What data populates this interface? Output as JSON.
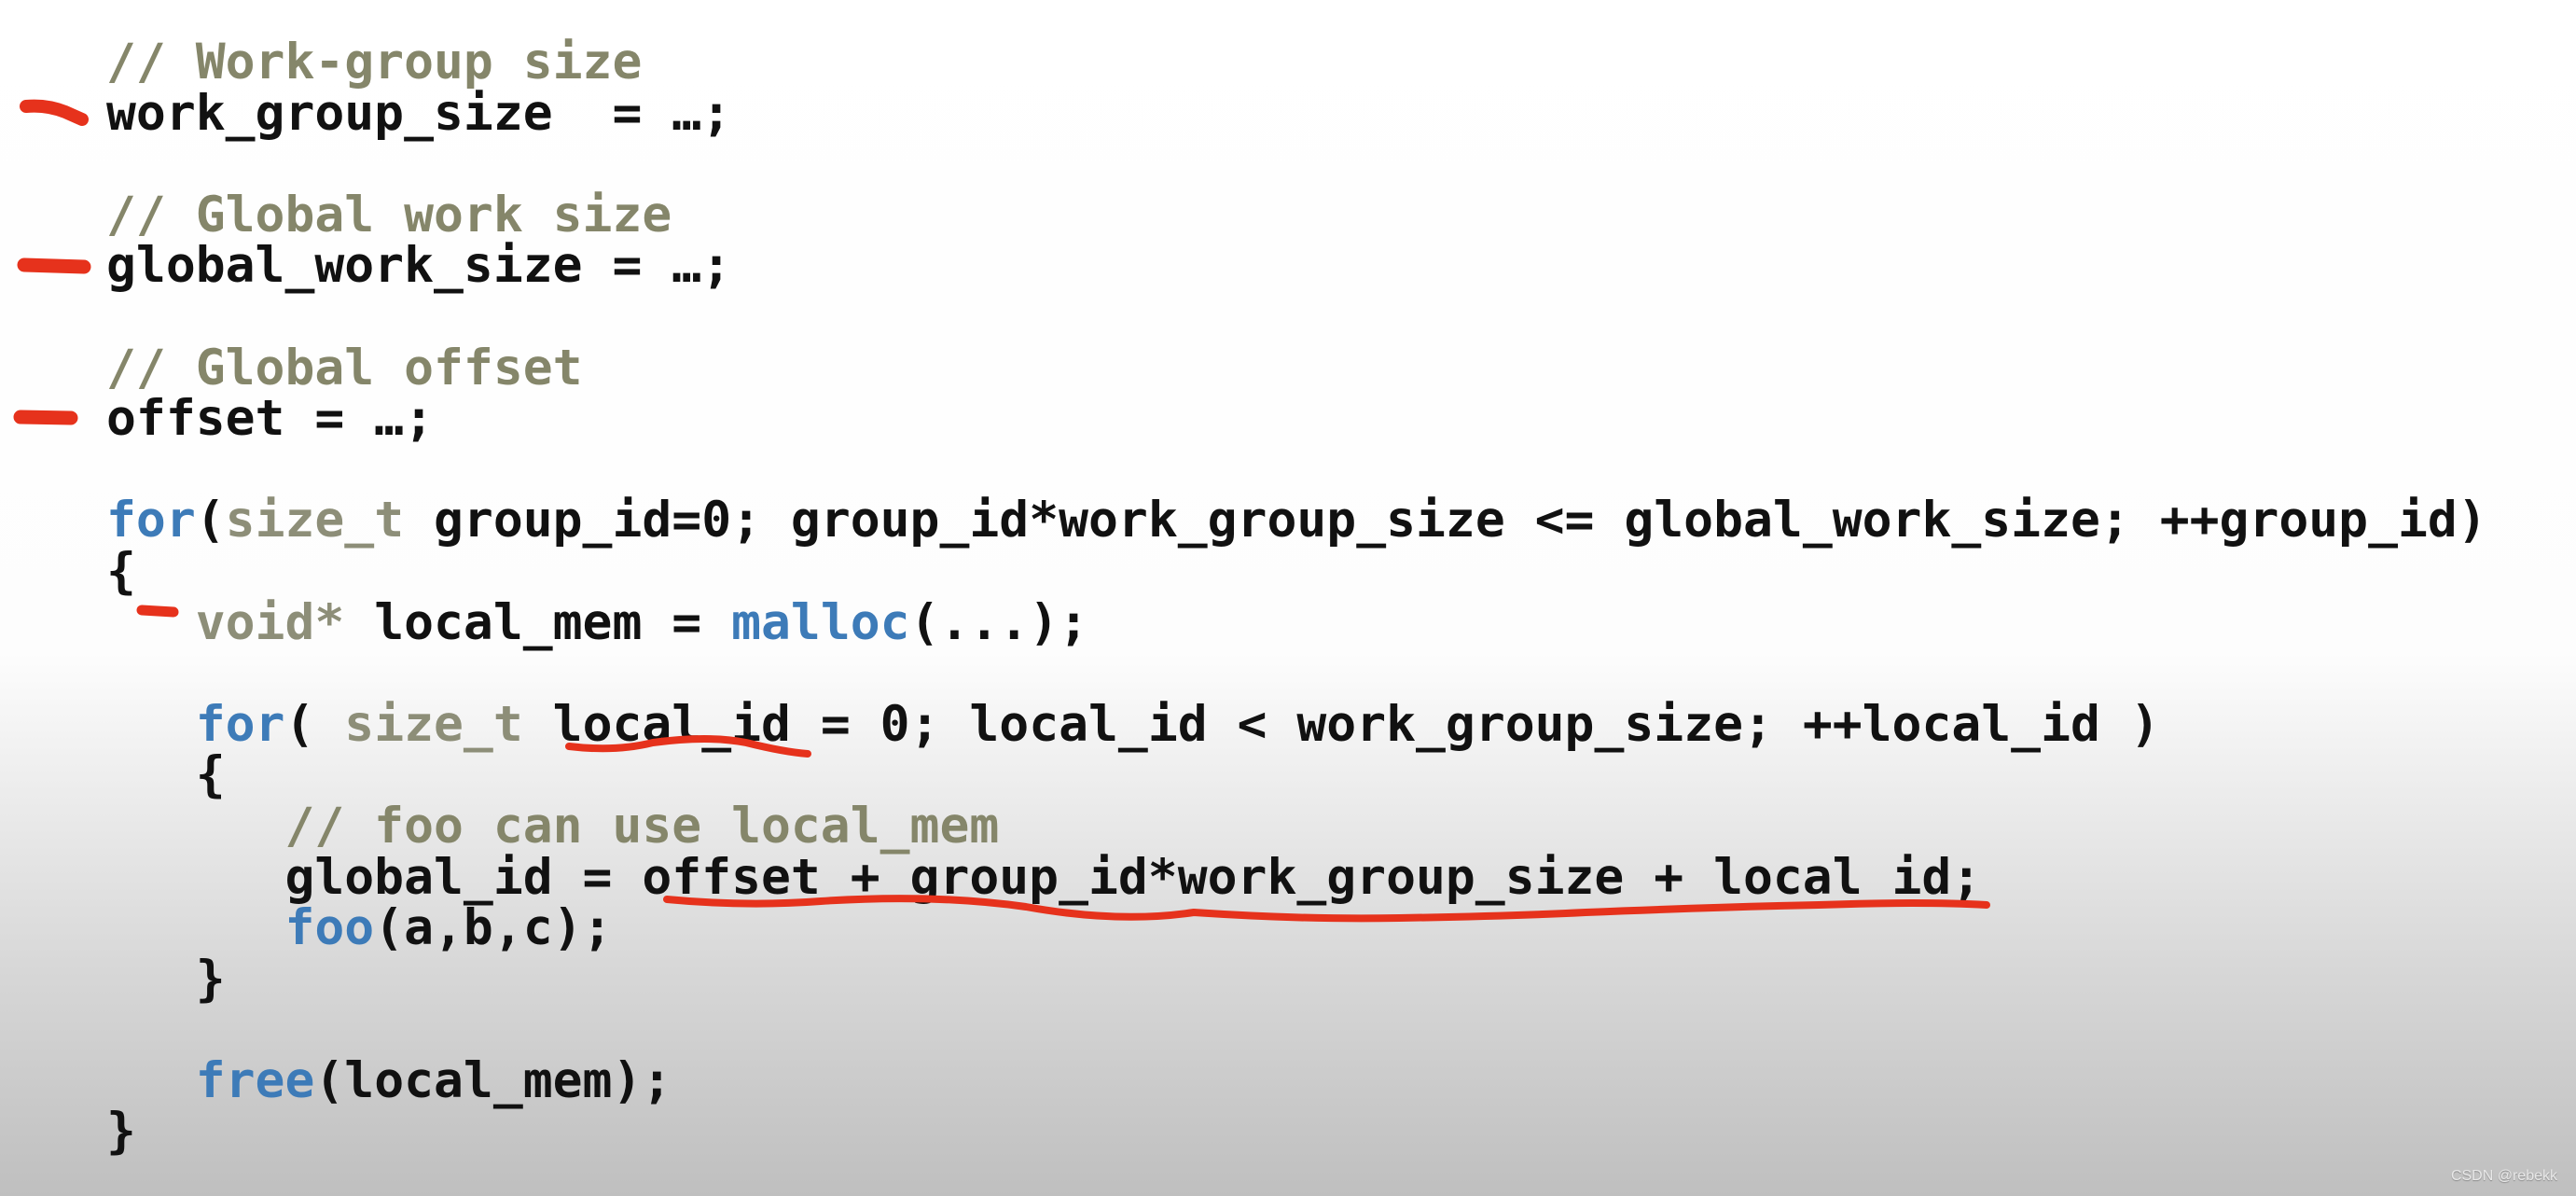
{
  "colors": {
    "comment": "#85866a",
    "type": "#8d8e78",
    "keyword": "#3d7bb8",
    "text": "#111111",
    "annotation": "#e6321c"
  },
  "code_lines": [
    [
      {
        "c": "comment",
        "t": "// Work-group size"
      }
    ],
    [
      {
        "c": "plain",
        "t": "work_group_size  = …;"
      }
    ],
    [],
    [
      {
        "c": "comment",
        "t": "// Global work size"
      }
    ],
    [
      {
        "c": "plain",
        "t": "global_work_size = …;"
      }
    ],
    [],
    [
      {
        "c": "comment",
        "t": "// Global offset"
      }
    ],
    [
      {
        "c": "plain",
        "t": "offset = …;"
      }
    ],
    [],
    [
      {
        "c": "kw",
        "t": "for"
      },
      {
        "c": "plain",
        "t": "("
      },
      {
        "c": "type",
        "t": "size_t"
      },
      {
        "c": "plain",
        "t": " group_id=0; group_id*work_group_size <= global_work_size; ++group_id)"
      }
    ],
    [
      {
        "c": "plain",
        "t": "{"
      }
    ],
    [
      {
        "c": "plain",
        "t": "   "
      },
      {
        "c": "type",
        "t": "void*"
      },
      {
        "c": "plain",
        "t": " local_mem = "
      },
      {
        "c": "kw",
        "t": "malloc"
      },
      {
        "c": "plain",
        "t": "(...);"
      }
    ],
    [],
    [
      {
        "c": "plain",
        "t": "   "
      },
      {
        "c": "kw",
        "t": "for"
      },
      {
        "c": "plain",
        "t": "( "
      },
      {
        "c": "type",
        "t": "size_t"
      },
      {
        "c": "plain",
        "t": " local_id = 0; local_id < work_group_size; ++local_id )"
      }
    ],
    [
      {
        "c": "plain",
        "t": "   {"
      }
    ],
    [
      {
        "c": "plain",
        "t": "      "
      },
      {
        "c": "comment",
        "t": "// foo can use local_mem"
      }
    ],
    [
      {
        "c": "plain",
        "t": "      global_id = offset + group_id*work_group_size + local_id;"
      }
    ],
    [
      {
        "c": "plain",
        "t": "      "
      },
      {
        "c": "kw",
        "t": "foo"
      },
      {
        "c": "plain",
        "t": "(a,b,c);"
      }
    ],
    [
      {
        "c": "plain",
        "t": "   }"
      }
    ],
    [],
    [
      {
        "c": "plain",
        "t": "   "
      },
      {
        "c": "kw",
        "t": "free"
      },
      {
        "c": "plain",
        "t": "(local_mem);"
      }
    ],
    [
      {
        "c": "plain",
        "t": "}"
      }
    ]
  ],
  "watermark": "CSDN @rebekk"
}
